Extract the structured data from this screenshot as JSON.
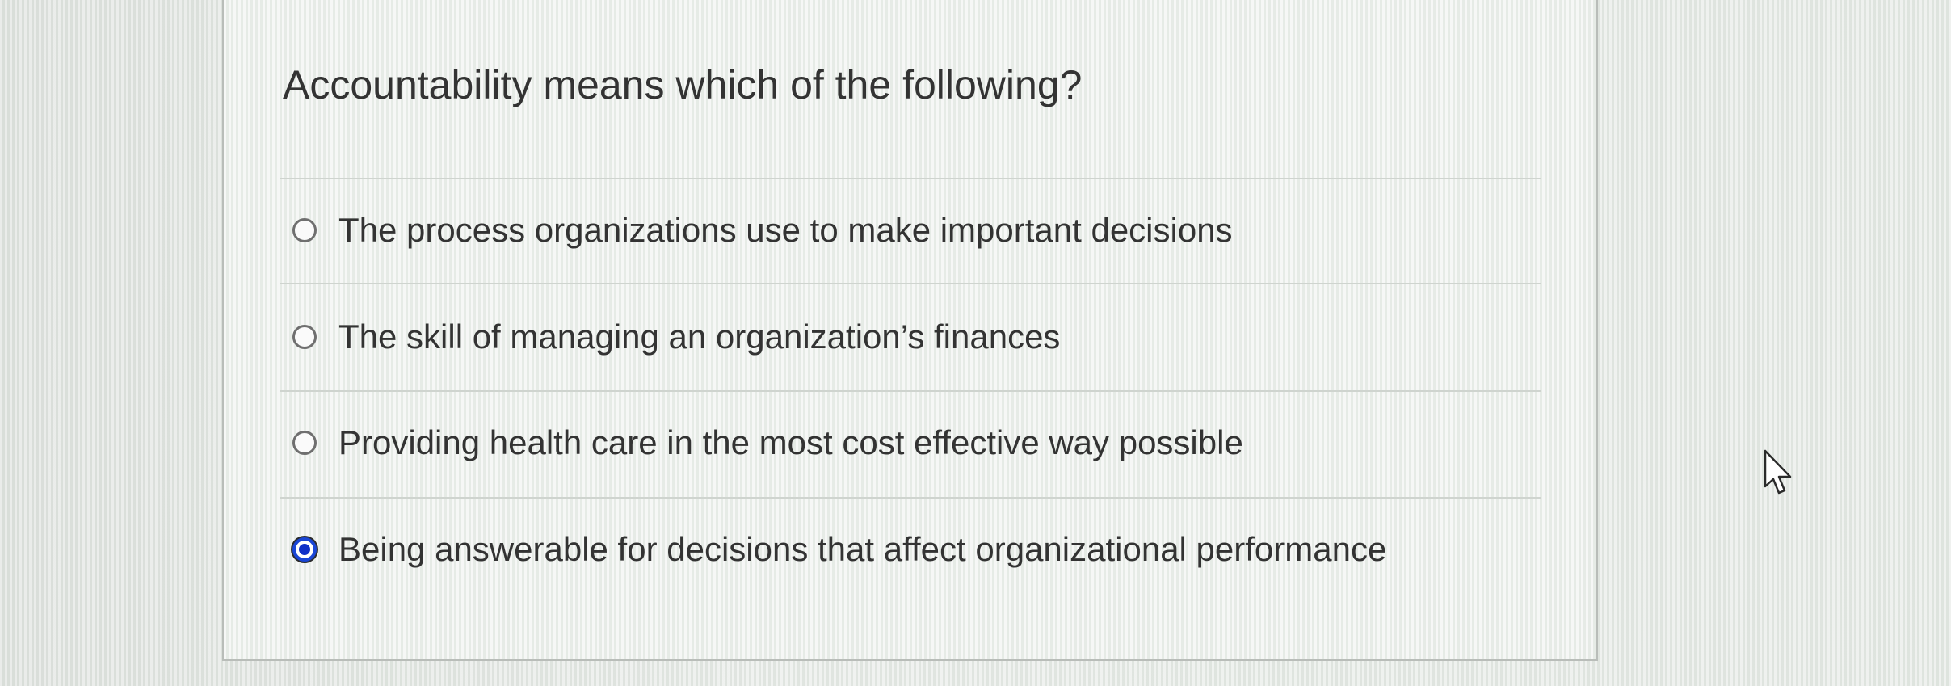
{
  "question": {
    "text": "Accountability means which of the following?"
  },
  "options": [
    {
      "label": "The process organizations use to make important decisions",
      "selected": false
    },
    {
      "label": "The skill of managing an organization’s finances",
      "selected": false
    },
    {
      "label": "Providing health care in the most cost effective way possible",
      "selected": false
    },
    {
      "label": "Being answerable for decisions that affect organizational performance",
      "selected": true
    }
  ],
  "colors": {
    "selected_radio": "#1a46d6",
    "text": "#333333",
    "card_border": "#b9bdb9"
  },
  "icons": {
    "cursor": "mouse-pointer-icon"
  }
}
